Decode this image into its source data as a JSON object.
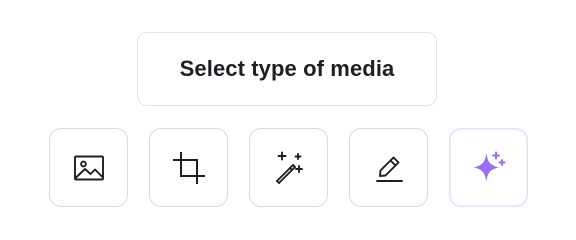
{
  "tooltip": {
    "label": "Select type of media"
  },
  "toolbar": {
    "buttons": [
      {
        "id": "image",
        "icon": "image-icon",
        "active": false
      },
      {
        "id": "crop",
        "icon": "crop-icon",
        "active": false
      },
      {
        "id": "magic-wand",
        "icon": "magic-wand-icon",
        "active": false
      },
      {
        "id": "edit",
        "icon": "pencil-icon",
        "active": false
      },
      {
        "id": "ai-sparkle",
        "icon": "sparkle-icon",
        "active": true
      }
    ]
  },
  "colors": {
    "text": "#1f1f23",
    "icon_stroke": "#1f1f23",
    "border": "#d9d9dd",
    "accent": "#9b6cf6",
    "active_border": "#e6dcfb"
  }
}
